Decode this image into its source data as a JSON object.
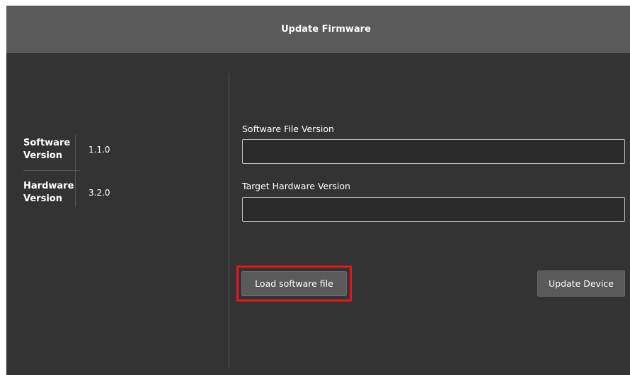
{
  "window": {
    "title": "Update Firmware"
  },
  "device_info": {
    "software_label_line1": "Software",
    "software_label_line2": "Version",
    "software_value": "1.1.0",
    "hardware_label_line1": "Hardware",
    "hardware_label_line2": "Version",
    "hardware_value": "3.2.0"
  },
  "form": {
    "software_file_version_label": "Software File Version",
    "software_file_version_value": "",
    "target_hardware_version_label": "Target Hardware Version",
    "target_hardware_version_value": ""
  },
  "actions": {
    "load_button_label": "Load software file",
    "update_button_label": "Update Device"
  },
  "colors": {
    "highlight": "#e8151b",
    "title_bar": "#5a5a5a",
    "panel_background": "#333333"
  }
}
